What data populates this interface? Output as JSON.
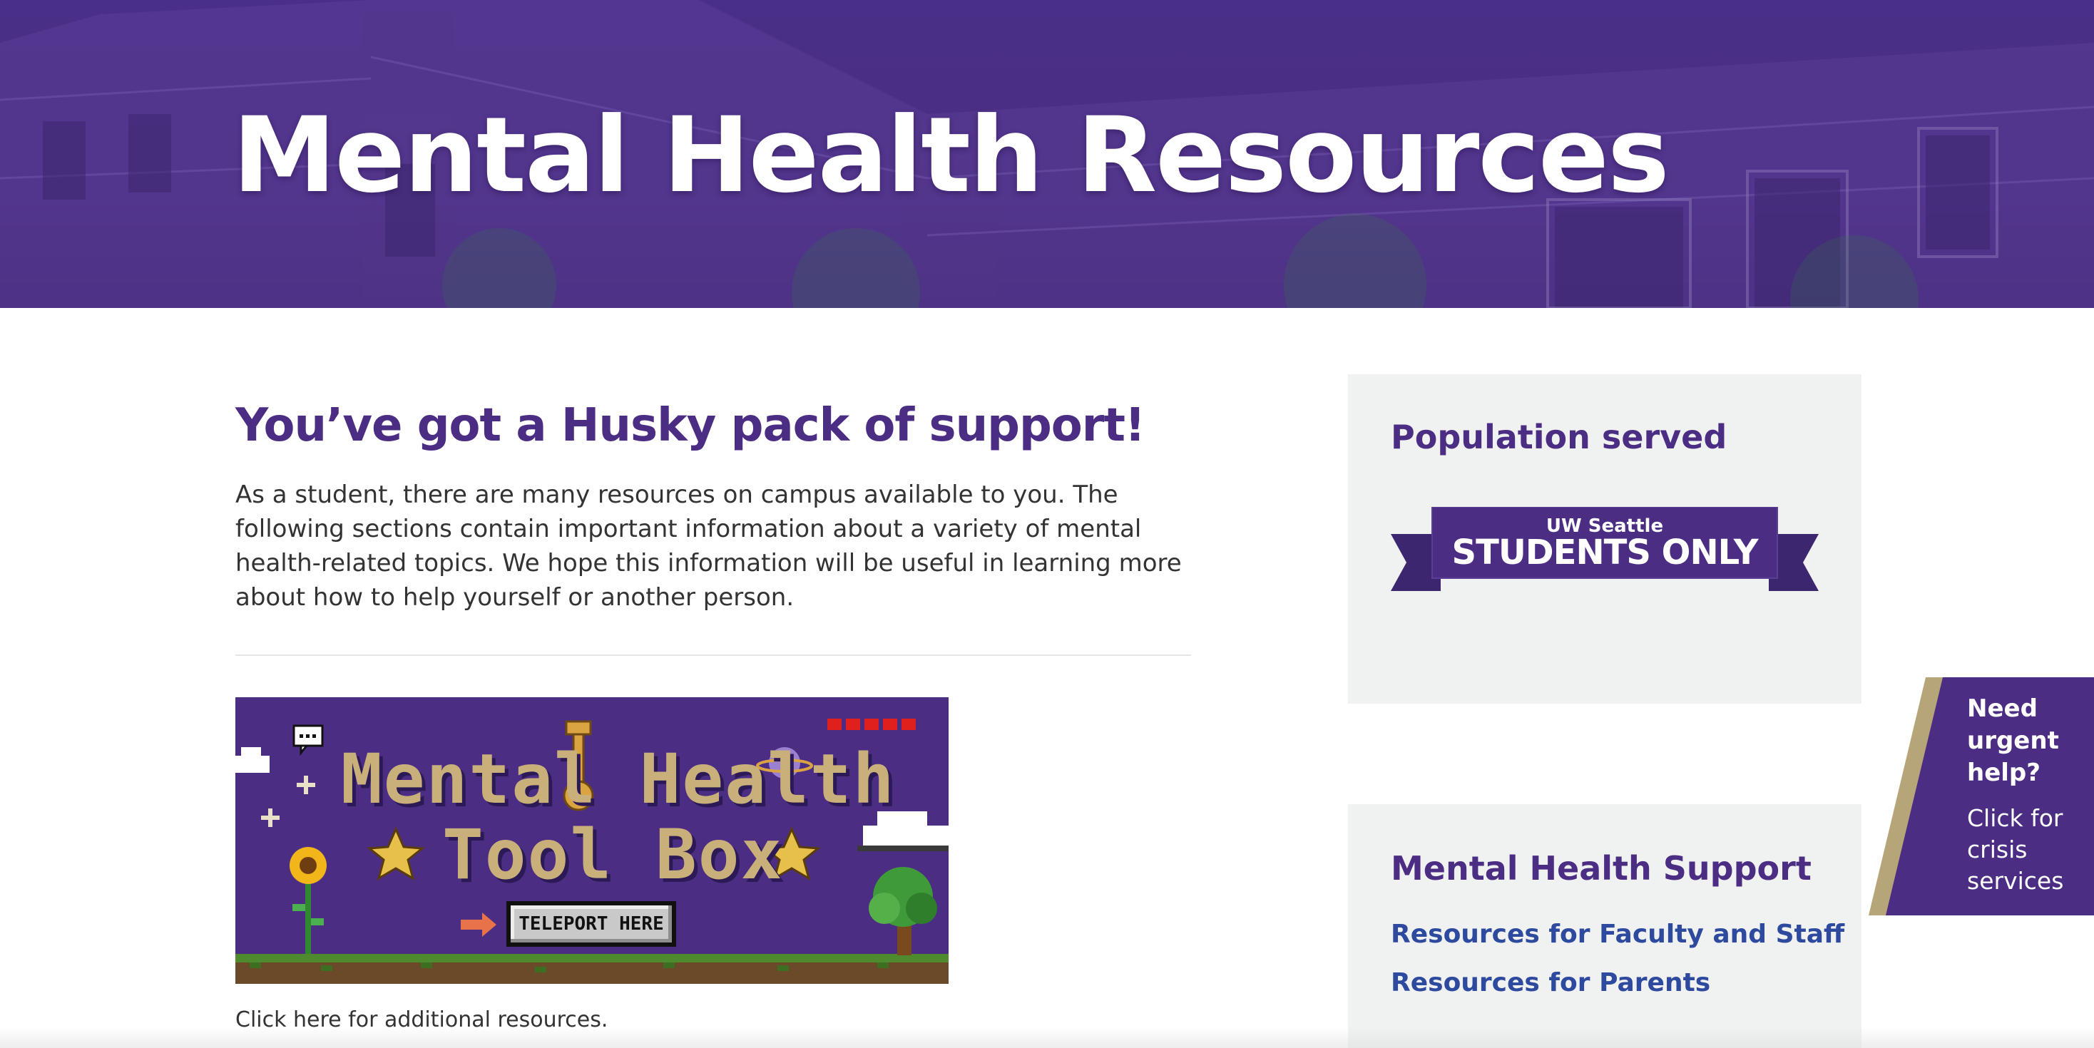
{
  "hero": {
    "title": "Mental Health Resources"
  },
  "intro": {
    "heading": "You’ve got a Husky pack of support!",
    "text": "As a student, there are many resources on campus available to you. The following sections contain important information about a variety of mental health-related topics. We hope this information will be useful in learning more about how to help yourself or another person."
  },
  "toolbox": {
    "title_line1": "Mental Health",
    "title_line2": "Tool Box",
    "button_label": "TELEPORT HERE",
    "caption": "Click here for additional resources."
  },
  "sidebar": {
    "population": {
      "heading": "Population served",
      "ribbon_top": "UW Seattle",
      "ribbon_main": "STUDENTS ONLY"
    },
    "support": {
      "heading": "Mental Health Support",
      "links": [
        {
          "label": "Resources for Faculty and Staff"
        },
        {
          "label": "Resources for Parents"
        }
      ]
    }
  },
  "urgent": {
    "heading": "Need urgent help?",
    "subtext": "Click for crisis services"
  },
  "colors": {
    "uw_purple": "#4b2e83",
    "uw_gold": "#b7a57a",
    "link_blue": "#2e4a9e",
    "card_gray": "#f0f2f2"
  }
}
